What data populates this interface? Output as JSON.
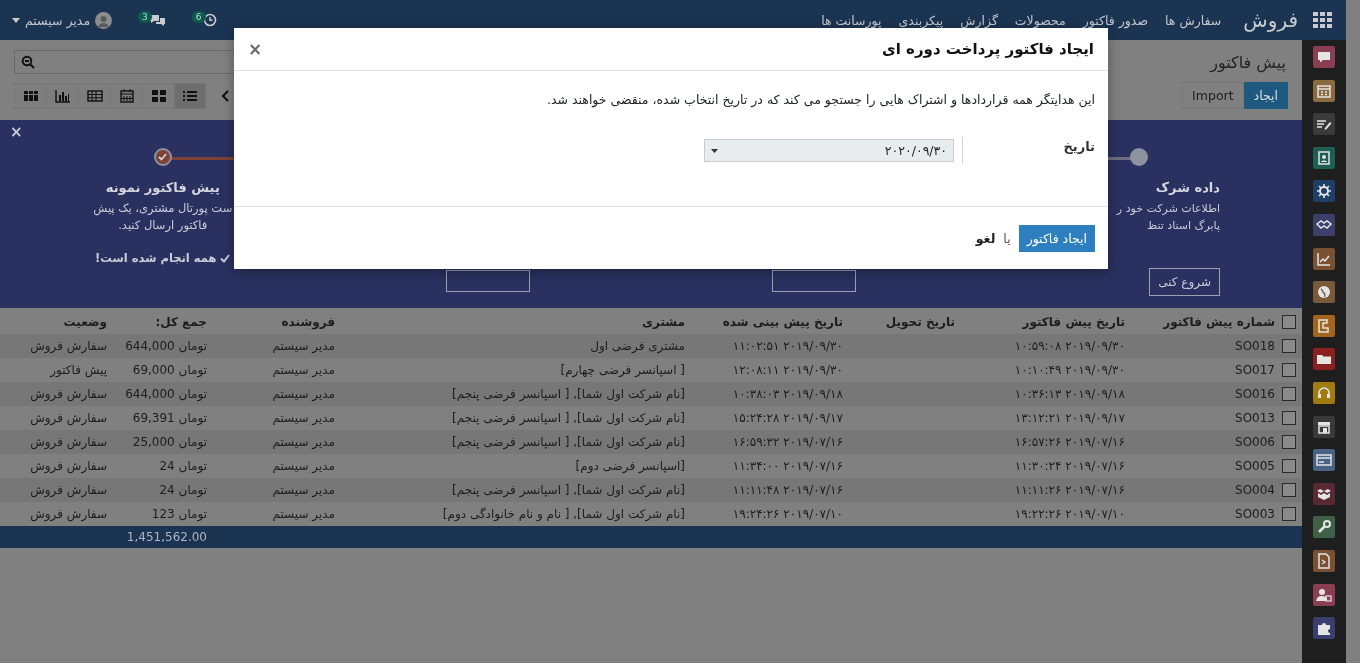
{
  "navbar": {
    "brand": "فروش",
    "menu": [
      "سفارش ها",
      "صدور فاکتور",
      "محصولات",
      "گزارش",
      "پیکربندی",
      "پورسانت ها"
    ],
    "activity_count": "6",
    "message_count": "3",
    "user": "مدیر سیستم"
  },
  "sidebar": {
    "apps": [
      {
        "kind": "chat",
        "color": "#8a3e52"
      },
      {
        "kind": "calendar",
        "color": "#8a6a3e"
      },
      {
        "kind": "note",
        "color": "#3a3a3a"
      },
      {
        "kind": "contacts",
        "color": "#1f5e55"
      },
      {
        "kind": "gear",
        "color": "#1f3f66"
      },
      {
        "kind": "handshake",
        "color": "#3c3f6a"
      },
      {
        "kind": "chart",
        "color": "#7a5032"
      },
      {
        "kind": "globe",
        "color": "#7a5a3a"
      },
      {
        "kind": "phone",
        "color": "#a2651e"
      },
      {
        "kind": "folder",
        "color": "#8a2020"
      },
      {
        "kind": "headset",
        "color": "#a07b10"
      },
      {
        "kind": "store",
        "color": "#3a3a3a"
      },
      {
        "kind": "card",
        "color": "#4a6285"
      },
      {
        "kind": "boxes",
        "color": "#5a2a34"
      },
      {
        "kind": "wrench",
        "color": "#3e6047"
      },
      {
        "kind": "document",
        "color": "#7a5032"
      },
      {
        "kind": "user",
        "color": "#8a3e52"
      },
      {
        "kind": "puzzle",
        "color": "#3a3f6e"
      }
    ]
  },
  "control_panel": {
    "breadcrumb": "پیش فاکتور",
    "create_button": "ایجاد",
    "import_button": "Import",
    "views": [
      {
        "kind": "list",
        "selected": true
      },
      {
        "kind": "kanban",
        "selected": false
      },
      {
        "kind": "calendar",
        "selected": false
      },
      {
        "kind": "pivot",
        "selected": false
      },
      {
        "kind": "graph",
        "selected": false
      },
      {
        "kind": "cohort",
        "selected": false
      }
    ]
  },
  "banner": {
    "close": "×",
    "steps": [
      {
        "kind": "step",
        "done": false,
        "title": "داده شرک",
        "description": [
          "اطلاعات شرکت خود ر",
          "پابرگ اسناد تنظ"
        ],
        "button": "شروع کنی"
      },
      {
        "kind": "covered"
      },
      {
        "kind": "covered"
      },
      {
        "kind": "step",
        "done": true,
        "title": "پیش فاکتور نمونه",
        "description": [
          "ست پورتال مشتری، یک پیش",
          "فاکتور ارسال کنید."
        ],
        "status": "همه انجام شده است!"
      }
    ]
  },
  "table": {
    "select_all_checked": false,
    "columns": [
      {
        "label": "شماره پیش فاکتور",
        "kind": "text"
      },
      {
        "label": "تاریخ پیش فاکتور",
        "kind": "text"
      },
      {
        "label": "تاریخ تحویل",
        "kind": "text"
      },
      {
        "label": "تاریخ پیش بینی شده",
        "kind": "text"
      },
      {
        "label": "مشتری",
        "kind": "text"
      },
      {
        "label": "فروشنده",
        "kind": "text"
      },
      {
        "label": "جمع کل:",
        "kind": "amount"
      },
      {
        "label": "وضعیت",
        "kind": "text"
      }
    ],
    "rows": [
      {
        "checked": false,
        "cells": [
          "SO018",
          "۲۰۱۹/۰۹/۳۰ ۱۰:۵۹:۰۸",
          "",
          "۲۰۱۹/۰۹/۳۰ ۱۱:۰۲:۵۱",
          "مشتری فرضی اول",
          "مدیر سیستم",
          "644,000 تومان",
          "سفارش فروش"
        ]
      },
      {
        "checked": false,
        "cells": [
          "SO017",
          "۲۰۱۹/۰۹/۳۰ ۱۰:۱۰:۴۹",
          "",
          "۲۰۱۹/۰۹/۳۰ ۱۲:۰۸:۱۱",
          "[ اسپانسر فرضی چهارم]",
          "مدیر سیستم",
          "69,000 تومان",
          "پیش فاکتور"
        ]
      },
      {
        "checked": false,
        "cells": [
          "SO016",
          "۲۰۱۹/۰۹/۱۸ ۱۰:۳۶:۱۳",
          "",
          "۲۰۱۹/۰۹/۱۸ ۱۰:۳۸:۰۳",
          "[نام شرکت اول شما], [ اسپانسر فرضی پنجم]",
          "مدیر سیستم",
          "644,000 تومان",
          "سفارش فروش"
        ]
      },
      {
        "checked": false,
        "cells": [
          "SO013",
          "۲۰۱۹/۰۹/۱۷ ۱۳:۱۲:۲۱",
          "",
          "۲۰۱۹/۰۹/۱۷ ۱۵:۲۴:۲۸",
          "[نام شرکت اول شما], [ اسپانسر فرضی پنجم]",
          "مدیر سیستم",
          "69,391 تومان",
          "سفارش فروش"
        ]
      },
      {
        "checked": false,
        "cells": [
          "SO006",
          "۲۰۱۹/۰۷/۱۶ ۱۶:۵۷:۲۶",
          "",
          "۲۰۱۹/۰۷/۱۶ ۱۶:۵۹:۳۲",
          "[نام شرکت اول شما], [ اسپانسر فرضی پنجم]",
          "مدیر سیستم",
          "25,000 تومان",
          "سفارش فروش"
        ]
      },
      {
        "checked": false,
        "cells": [
          "SO005",
          "۲۰۱۹/۰۷/۱۶ ۱۱:۳۰:۲۴",
          "",
          "۲۰۱۹/۰۷/۱۶ ۱۱:۳۴:۰۰",
          "[اسپانسر فرضی دوم]",
          "مدیر سیستم",
          "24 تومان",
          "سفارش فروش"
        ]
      },
      {
        "checked": false,
        "cells": [
          "SO004",
          "۲۰۱۹/۰۷/۱۶ ۱۱:۱۱:۲۶",
          "",
          "۲۰۱۹/۰۷/۱۶ ۱۱:۱۱:۴۸",
          "[نام شرکت اول شما], [ اسپانسر فرضی پنجم]",
          "مدیر سیستم",
          "24 تومان",
          "سفارش فروش"
        ]
      },
      {
        "checked": false,
        "cells": [
          "SO003",
          "۲۰۱۹/۰۷/۱۰ ۱۹:۲۲:۲۶",
          "",
          "۲۰۱۹/۰۷/۱۰ ۱۹:۲۴:۲۶",
          "[نام شرکت اول شما], [ نام و نام خانوادگی دوم]",
          "مدیر سیستم",
          "123 تومان",
          "سفارش فروش"
        ]
      }
    ],
    "total": "1,451,562.00"
  },
  "dialog": {
    "title": "ایجاد فاکتور پرداخت دوره ای",
    "close": "×",
    "description": "این هدایتگر همه قراردادها و اشتراک هایی را جستجو می کند که در تاریخ انتخاب شده، منقضی خواهند شد.",
    "field_label": "تاریخ",
    "date_value": "۲۰۲۰/۰۹/۳۰",
    "confirm_button": "ایجاد فاکتور",
    "separator": "یا",
    "cancel_link": "لغو"
  }
}
